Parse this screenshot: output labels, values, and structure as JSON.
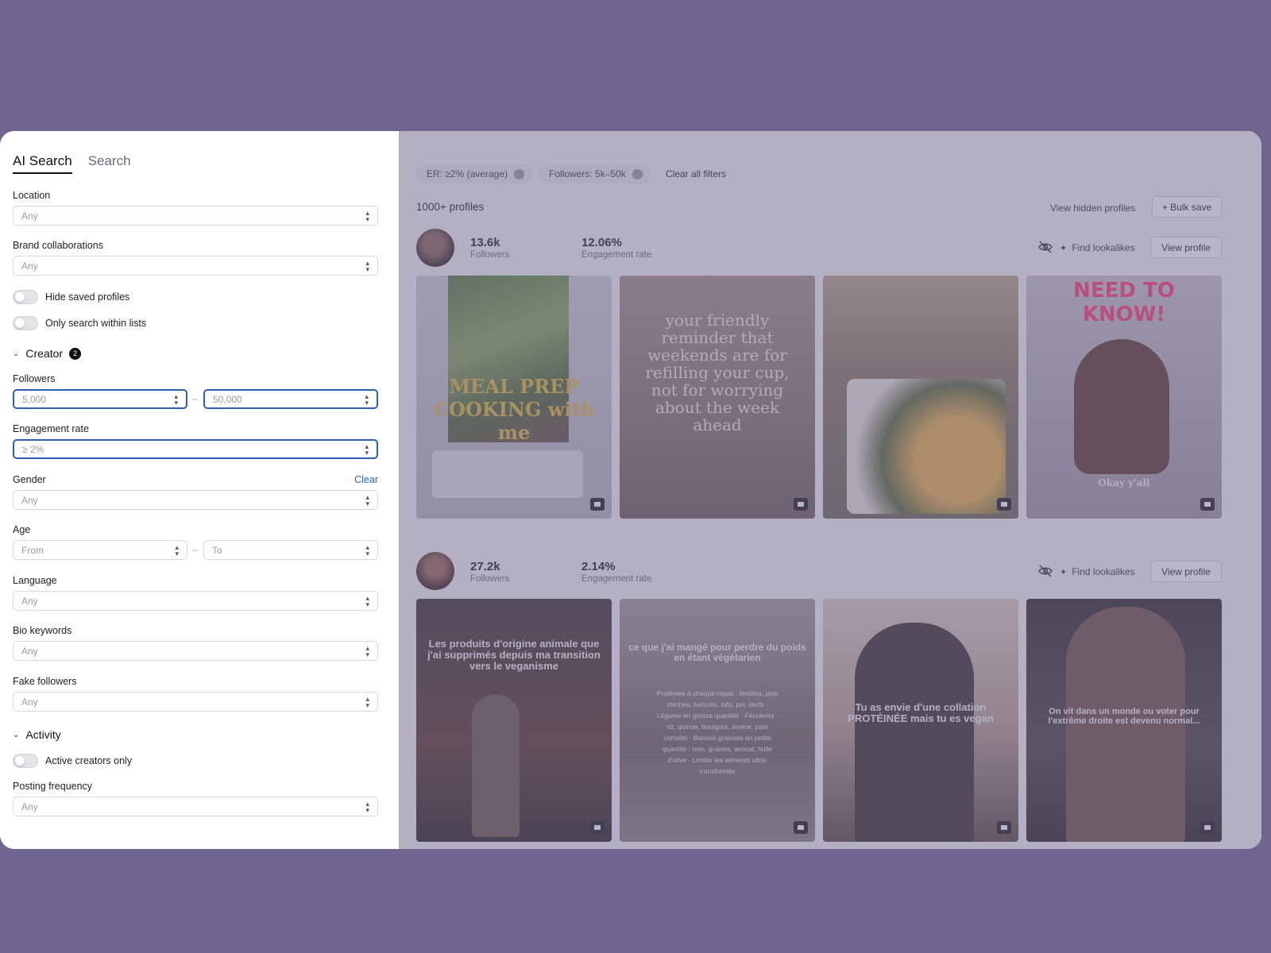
{
  "tabs": [
    {
      "label": "AI Search"
    },
    {
      "label": "Search"
    }
  ],
  "filters": {
    "location": {
      "label": "Location",
      "value": "Any"
    },
    "brand": {
      "label": "Brand collaborations",
      "value": "Any"
    },
    "hide_saved": "Hide saved profiles",
    "only_lists": "Only search within lists",
    "creator_section": {
      "label": "Creator",
      "count": "2"
    },
    "followers": {
      "label": "Followers",
      "min": "5,000",
      "max": "50,000",
      "sep": "–"
    },
    "engagement": {
      "label": "Engagement rate",
      "value": "≥ 2%"
    },
    "gender": {
      "label": "Gender",
      "clear": "Clear",
      "value": "Any"
    },
    "age": {
      "label": "Age",
      "from": "From",
      "to": "To",
      "sep": "–"
    },
    "language": {
      "label": "Language",
      "value": "Any"
    },
    "bio": {
      "label": "Bio keywords",
      "value": "Any"
    },
    "fake": {
      "label": "Fake followers",
      "value": "Any"
    },
    "activity_section": {
      "label": "Activity"
    },
    "active_only": "Active creators only",
    "posting": {
      "label": "Posting frequency",
      "value": "Any"
    }
  },
  "results": {
    "chips": [
      "ER: ≥2% (average)",
      "Followers: 5k–50k"
    ],
    "clear_all": "Clear all filters",
    "count": "1000+ profiles",
    "view_hidden": "View hidden profiles",
    "bulk_save": "+ Bulk save",
    "find_lookalikes": "Find lookalikes",
    "view_profile": "View profile",
    "followers_label": "Followers",
    "er_label": "Engagement rate",
    "profiles": [
      {
        "followers": "13.6k",
        "er": "12.06%",
        "posts": [
          {
            "caption": "MEAL PREP COOKING with me",
            "bg": "#b9b9c1"
          },
          {
            "caption": "your friendly reminder that weekends are for refilling your cup, not for worrying about the week ahead",
            "bg": "#8c7d76"
          },
          {
            "caption": "",
            "bg": "#9a8d74"
          },
          {
            "caption": "NEED TO KNOW!",
            "sub": "Okay y'all",
            "bg": "#a9a5a6"
          }
        ]
      },
      {
        "followers": "27.2k",
        "er": "2.14%",
        "posts": [
          {
            "caption": "Les produits d'origine animale que j'ai supprimés depuis ma transition vers le veganisme",
            "bg": "#3d3533"
          },
          {
            "caption": "ce que j'ai mangé pour perdre du poids en étant végétarien",
            "sub": "Protéines à chaque repas : lentilles, pois chiches, haricots, tofu, psl, œufs · Légume en grosse quantité · Féculents : riz, quinoa, boulgour, avoine, pain complet · Bonnes graisses en petite quantité : noix, graines, avocat, huile d'olive · Limiter les aliments ultra-transformés",
            "bg": "#7e7672"
          },
          {
            "caption": "Tu as envie d'une collation PROTÉINÉE mais tu es vegan",
            "bg": "#8f817a"
          },
          {
            "caption": "On vit dans un monde ou voter pour l'extrême droite est devenu normal...",
            "bg": "#3c3838"
          }
        ]
      }
    ]
  }
}
